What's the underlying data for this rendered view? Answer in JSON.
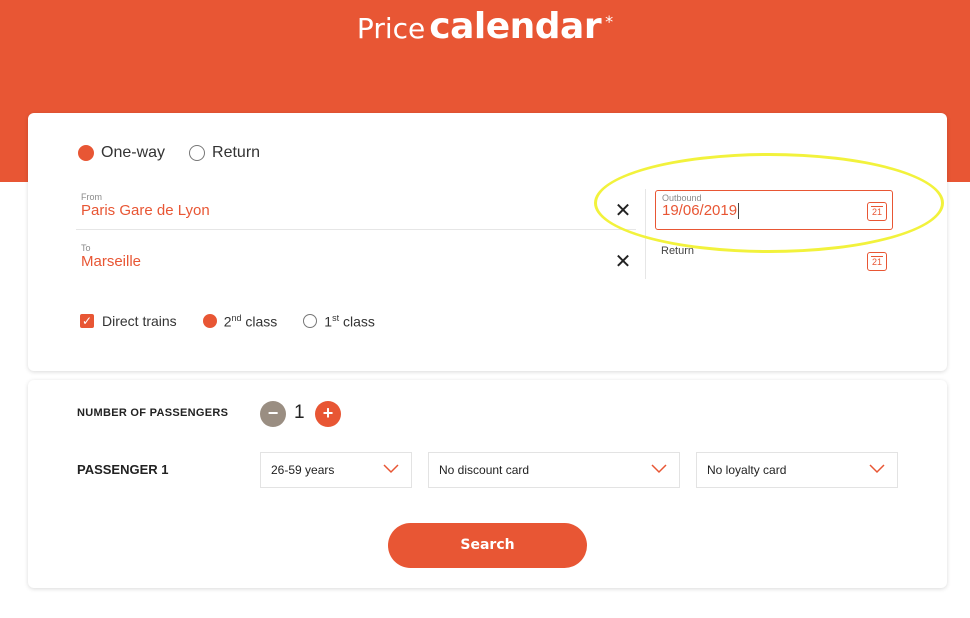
{
  "header": {
    "title_light": "Price",
    "title_bold": "calendar",
    "title_mark": "*"
  },
  "trip_type": {
    "one_way_label": "One-way",
    "return_label": "Return",
    "selected": "One-way"
  },
  "route": {
    "from_label": "From",
    "from_value": "Paris Gare de Lyon",
    "to_label": "To",
    "to_value": "Marseille"
  },
  "dates": {
    "outbound_label": "Outbound",
    "outbound_value": "19/06/2019",
    "return_label": "Return",
    "calendar_day": "21"
  },
  "options": {
    "direct_label": "Direct trains",
    "second_class_num": "2",
    "second_class_sup": "nd",
    "second_class_word": " class",
    "first_class_num": "1",
    "first_class_sup": "st",
    "first_class_word": " class"
  },
  "passengers": {
    "count_label": "NUMBER OF PASSENGERS",
    "count": "1",
    "minus": "−",
    "plus": "+",
    "passenger1_label": "PASSENGER 1",
    "age_value": "26-59 years",
    "discount_value": "No discount card",
    "loyalty_value": "No loyalty card"
  },
  "actions": {
    "search_label": "Search"
  },
  "colors": {
    "accent": "#e85634",
    "highlight": "#f2f23c"
  }
}
